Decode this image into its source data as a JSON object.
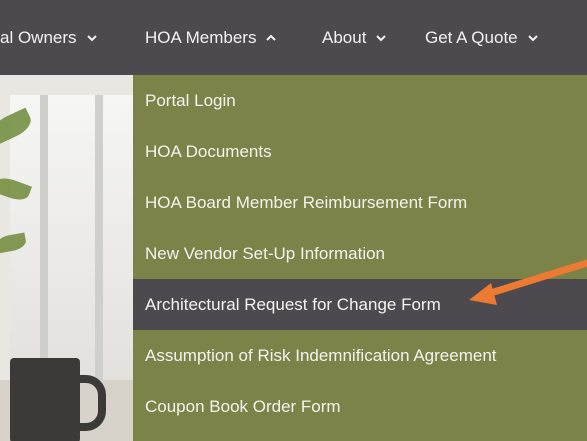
{
  "nav": {
    "items": [
      {
        "label": "al Owners",
        "chevron": "chevron-down"
      },
      {
        "label": "HOA Members",
        "chevron": "chevron-up"
      },
      {
        "label": "About",
        "chevron": "chevron-down"
      },
      {
        "label": "Get A Quote",
        "chevron": "chevron-down"
      }
    ]
  },
  "dropdown": {
    "items": [
      {
        "label": "Portal Login"
      },
      {
        "label": "HOA Documents"
      },
      {
        "label": "HOA Board Member Reimbursement Form"
      },
      {
        "label": "New Vendor Set-Up Information"
      },
      {
        "label": "Architectural Request for Change Form",
        "highlighted": true
      },
      {
        "label": "Assumption of Risk Indemnification Agreement"
      },
      {
        "label": "Coupon Book Order Form"
      }
    ]
  },
  "colors": {
    "nav_bg": "#4d4a4f",
    "dropdown_bg": "#7b8349",
    "highlight_bg": "#4d4a4f",
    "annotation_arrow": "#ec7a32"
  }
}
